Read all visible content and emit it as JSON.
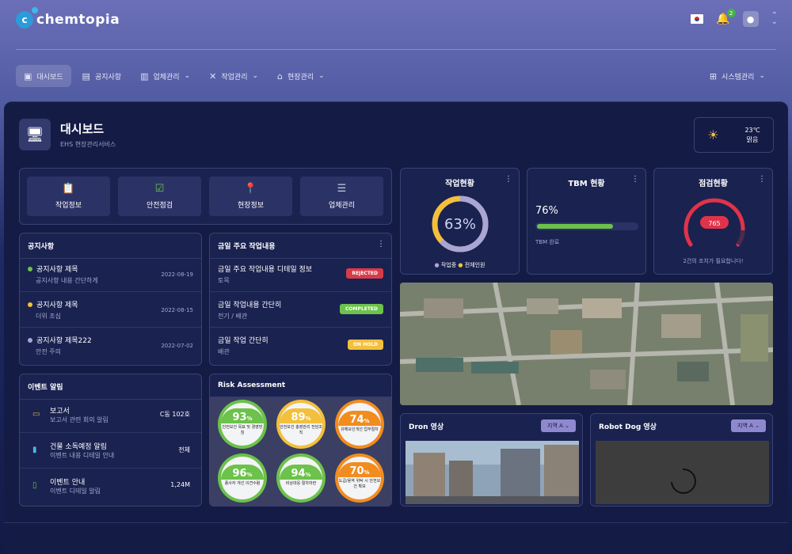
{
  "app": {
    "logo_mark": "c",
    "logo_text": "chemtopia"
  },
  "topbar": {
    "notifications_count": "2",
    "avatar_icon": "user-icon"
  },
  "nav": {
    "items": [
      {
        "label": "대시보드",
        "icon": "dashboard-icon",
        "active": true
      },
      {
        "label": "공지사항",
        "icon": "notice-icon",
        "active": false
      },
      {
        "label": "업체관리",
        "icon": "building-icon",
        "active": false
      },
      {
        "label": "작업관리",
        "icon": "tools-icon",
        "active": false
      },
      {
        "label": "현장관리",
        "icon": "site-icon",
        "active": false
      }
    ],
    "right_item": {
      "label": "시스템관리",
      "icon": "system-icon"
    }
  },
  "header": {
    "title": "대시보드",
    "subtitle": "EHS 현장관리서비스"
  },
  "weather": {
    "temp": "23℃",
    "condition": "맑음"
  },
  "quick_buttons": [
    {
      "label": "작업정보",
      "icon": "clipboard-icon",
      "color": "#f2c03c"
    },
    {
      "label": "안전점검",
      "icon": "checklist-icon",
      "color": "#6cc24a"
    },
    {
      "label": "현장정보",
      "icon": "location-pin-icon",
      "color": "#49b8e8"
    },
    {
      "label": "업체관리",
      "icon": "list-icon",
      "color": "#c7cbe6"
    }
  ],
  "notices": {
    "title": "공지사항",
    "items": [
      {
        "title": "공지사항 제목",
        "sub": "공지사항 내용 간단하게",
        "date": "2022-08-19",
        "color": "#6cc24a"
      },
      {
        "title": "공지사항 제목",
        "sub": "더위 조심",
        "date": "2022-08-15",
        "color": "#f2c03c"
      },
      {
        "title": "공지사항 제목222",
        "sub": "안전 주의",
        "date": "2022-07-02",
        "color": "#a9a6d6"
      }
    ]
  },
  "today_work": {
    "title": "금일 주요 작업내용",
    "items": [
      {
        "title": "금일 주요 작업내용 디테일 정보",
        "sub": "토목",
        "status": "REJECTED",
        "status_bg": "#d83a4a",
        "status_fg": "#ffffff"
      },
      {
        "title": "금일 작업내용 간단히",
        "sub": "전기 / 배관",
        "status": "COMPLETED",
        "status_bg": "#6cc24a",
        "status_fg": "#ffffff"
      },
      {
        "title": "금일 작업 간단히",
        "sub": "배관",
        "status": "ON HOLD",
        "status_bg": "#f2c03c",
        "status_fg": "#ffffff"
      }
    ]
  },
  "events": {
    "title": "이벤트 알림",
    "items": [
      {
        "title": "보고서",
        "sub": "보고서 관련 회의 알림",
        "value": "C동 102호",
        "icon": "report-icon"
      },
      {
        "title": "건물 소독예정 알림",
        "sub": "이벤트 내용 디테일 안내",
        "value": "전체",
        "icon": "building-file-icon"
      },
      {
        "title": "이벤트 안내",
        "sub": "이벤트 디테일 알림",
        "value": "1,24M",
        "icon": "event-icon"
      }
    ]
  },
  "risk": {
    "title": "Risk Assessment",
    "items": [
      {
        "value": "93",
        "unit": "%",
        "label": "안전보건 목표 및 경영방침",
        "color": "#6cc24a"
      },
      {
        "value": "89",
        "unit": "%",
        "label": "안전보건 총괄관리 전담조직",
        "color": "#f2c03c"
      },
      {
        "value": "74",
        "unit": "%",
        "label": "유해요인개선 업무절차",
        "color": "#f28c1e"
      },
      {
        "value": "96",
        "unit": "%",
        "label": "종사자 개선 의견수렴",
        "color": "#6cc24a"
      },
      {
        "value": "94",
        "unit": "%",
        "label": "비상대응 절차마련",
        "color": "#6cc24a"
      },
      {
        "value": "70",
        "unit": "%",
        "label": "도급/용역 위탁 시 안전보건 확보",
        "color": "#f28c1e"
      }
    ]
  },
  "work_status": {
    "title": "작업현황",
    "percent_label": "63%",
    "fraction": 0.63,
    "legend_active": "작업중",
    "legend_total": "전체인원"
  },
  "tbm": {
    "title": "TBM 현황",
    "value_label": "76%",
    "fraction": 0.76,
    "caption": "TBM 완료"
  },
  "inspection": {
    "title": "점검현황",
    "count": "765",
    "caption": "2건의 조치가 필요합니다!"
  },
  "drone": {
    "title": "Dron 영상",
    "region": "지역 A"
  },
  "robot": {
    "title": "Robot Dog 영상",
    "region": "지역 A"
  }
}
